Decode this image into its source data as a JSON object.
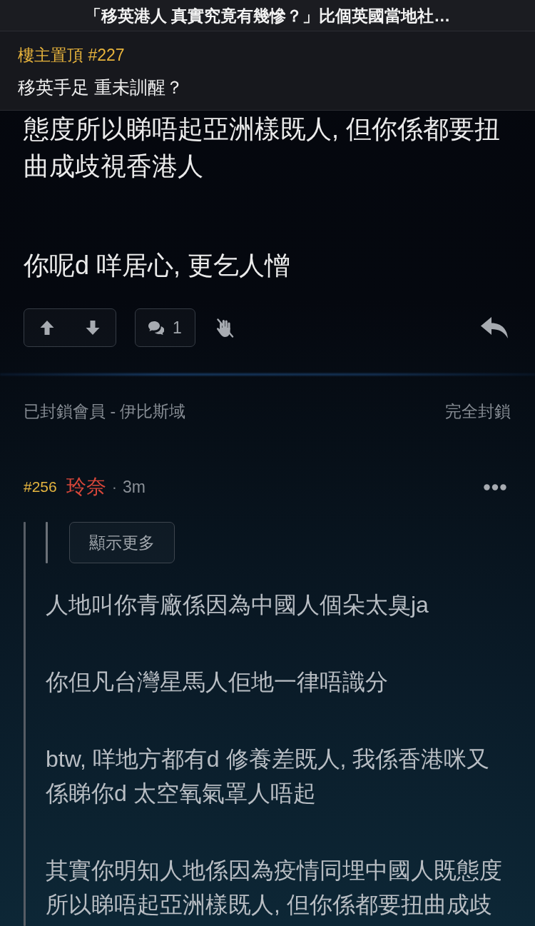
{
  "header": {
    "title": "「移英港人 真實究竟有幾慘？」比個英國當地社…"
  },
  "pinned": {
    "label": "樓主置頂 #227",
    "text": "移英手足 重未訓醒？"
  },
  "post": {
    "paragraphs": [
      "態度所以睇唔起亞洲樣既人, 但你係都要扭曲成歧視香港人",
      "你呢d 咩居心, 更乞人憎"
    ],
    "comment_count": "1"
  },
  "blocked": {
    "text": "已封鎖會員 - 伊比斯域",
    "action": "完全封鎖"
  },
  "reply": {
    "number": "#256",
    "author": "玲奈",
    "separator": "·",
    "time": "3m",
    "quote": {
      "show_more": "顯示更多",
      "paragraphs": [
        "人地叫你青廠係因為中國人個朵太臭ja",
        "你但凡台灣星馬人佢地一律唔識分",
        "btw, 咩地方都有d 修養差既人, 我係香港咪又係睇你d 太空氧氣罩人唔起",
        "其實你明知人地係因為疫情同埋中國人既態度所以睇唔起亞洲樣既人, 但你係都要扭曲成歧"
      ]
    }
  }
}
